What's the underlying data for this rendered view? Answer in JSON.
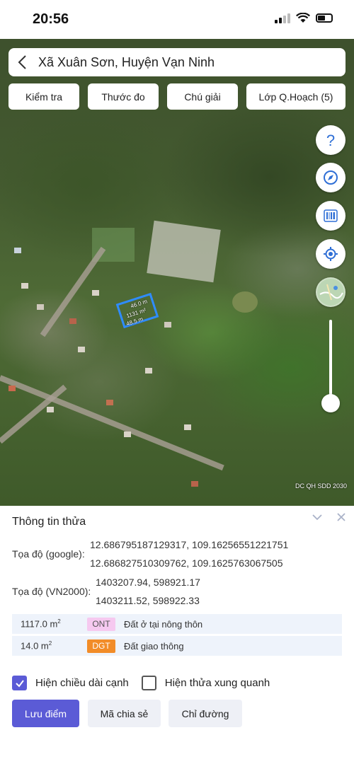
{
  "status_bar": {
    "time": "20:56"
  },
  "search": {
    "location": "Xã Xuân Sơn, Huyện Vạn Ninh"
  },
  "tools": [
    "Kiểm tra",
    "Thước đo",
    "Chú giải",
    "Lớp Q.Hoạch (5)"
  ],
  "map": {
    "parcel_labels": [
      "46.0 m",
      "1131 m²",
      "48.5 m"
    ],
    "layer_watermark": "DC QH SDD 2030",
    "parcel_outline_color": "#2f8cff"
  },
  "map_controls": [
    "help-icon",
    "compass-icon",
    "barcode-icon",
    "locate-icon",
    "basemap-icon"
  ],
  "panel": {
    "title": "Thông tin thửa",
    "google_label": "Tọa độ (google):",
    "google_coords": [
      "12.686795187129317, 109.16256551221751",
      "12.686827510309762, 109.1625763067505"
    ],
    "vn2000_label": "Tọa độ (VN2000):",
    "vn2000_coords": [
      "1403207.94, 598921.17",
      "1403211.52, 598922.33"
    ],
    "land_use": [
      {
        "area": "1117.0 m",
        "sup": "2",
        "code": "ONT",
        "desc": "Đất ở tại nông thôn",
        "code_bg": "#f6c9f0",
        "code_color": "#555"
      },
      {
        "area": "14.0 m",
        "sup": "2",
        "code": "DGT",
        "desc": "Đất giao thông",
        "code_bg": "#f28c28",
        "code_color": "#fff"
      }
    ],
    "show_edge_lengths": "Hiện chiều dài cạnh",
    "show_neighbors": "Hiện thửa xung quanh",
    "buttons": {
      "save": "Lưu điểm",
      "share": "Mã chia sẻ",
      "directions": "Chỉ đường"
    }
  },
  "colors": {
    "accent": "#5b5bd6",
    "control_icon": "#2f6fd6"
  }
}
